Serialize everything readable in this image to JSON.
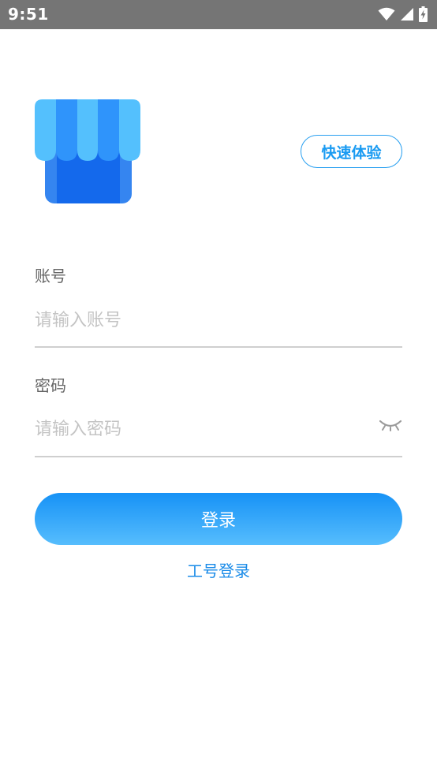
{
  "status_bar": {
    "time": "9:51",
    "icons": [
      "wifi-icon",
      "signal-icon",
      "battery-charging-icon"
    ]
  },
  "logo": {
    "icon": "store-awning-icon"
  },
  "quick_experience": {
    "label": "快速体验"
  },
  "account": {
    "label": "账号",
    "placeholder": "请输入账号",
    "value": ""
  },
  "password": {
    "label": "密码",
    "placeholder": "请输入密码",
    "value": "",
    "toggle_icon": "eye-closed-icon"
  },
  "login": {
    "label": "登录"
  },
  "staff_login": {
    "label": "工号登录"
  },
  "colors": {
    "accent": "#1a9bf2",
    "button_gradient_top": "#1792f6",
    "button_gradient_bottom": "#56bdfd",
    "status_bar": "#757575"
  }
}
